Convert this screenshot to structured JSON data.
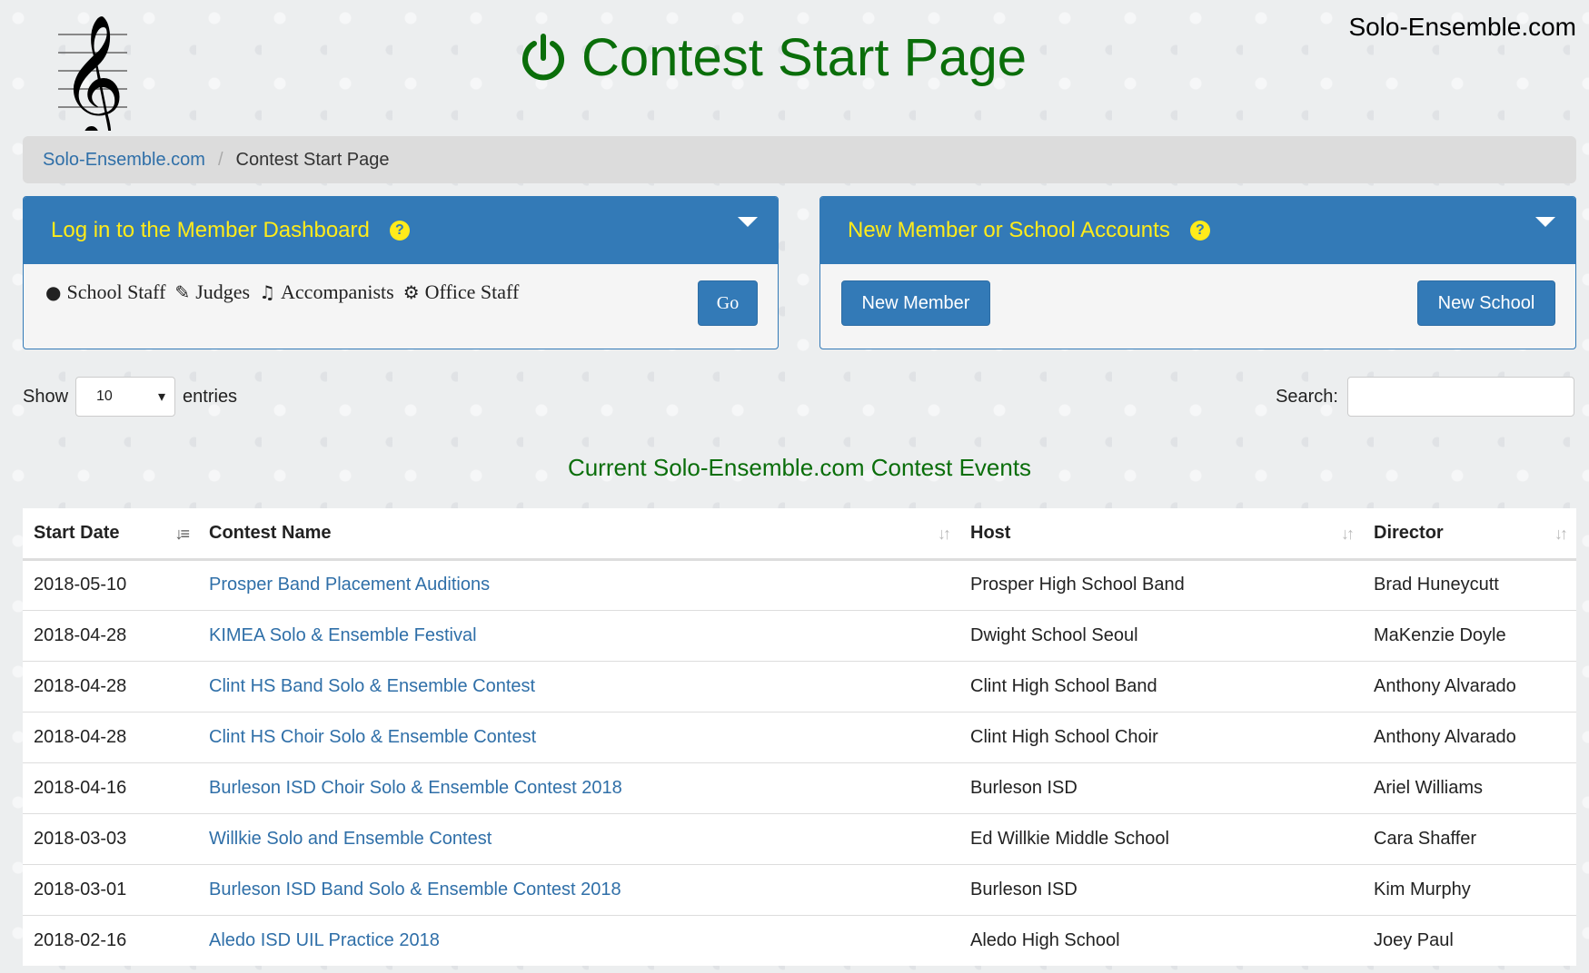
{
  "header": {
    "site_link": "Solo-Ensemble.com",
    "page_title": "Contest Start Page"
  },
  "breadcrumb": {
    "home": "Solo-Ensemble.com",
    "current": "Contest Start Page"
  },
  "login_panel": {
    "title": "Log in to the Member Dashboard",
    "roles": [
      {
        "icon": "apple-icon",
        "label": "School Staff"
      },
      {
        "icon": "edit-icon",
        "label": "Judges"
      },
      {
        "icon": "music-note-icon",
        "label": "Accompanists"
      },
      {
        "icon": "gear-icon",
        "label": "Office Staff"
      }
    ],
    "go_label": "Go"
  },
  "accounts_panel": {
    "title": "New Member or School Accounts",
    "new_member_label": "New Member",
    "new_school_label": "New School"
  },
  "table_controls": {
    "show_label": "Show",
    "entries_value": "10",
    "entries_label": "entries",
    "search_label": "Search:"
  },
  "caption": "Current Solo-Ensemble.com Contest Events",
  "table": {
    "headers": [
      "Start Date",
      "Contest Name",
      "Host",
      "Director"
    ],
    "rows": [
      {
        "date": "2018-05-10",
        "name": "Prosper Band Placement Auditions",
        "host": "Prosper High School Band",
        "director": "Brad Huneycutt"
      },
      {
        "date": "2018-04-28",
        "name": "KIMEA Solo & Ensemble Festival",
        "host": "Dwight School Seoul",
        "director": "MaKenzie Doyle"
      },
      {
        "date": "2018-04-28",
        "name": "Clint HS Band Solo & Ensemble Contest",
        "host": "Clint High School Band",
        "director": "Anthony Alvarado"
      },
      {
        "date": "2018-04-28",
        "name": "Clint HS Choir Solo & Ensemble Contest",
        "host": "Clint High School Choir",
        "director": "Anthony Alvarado"
      },
      {
        "date": "2018-04-16",
        "name": "Burleson ISD Choir Solo & Ensemble Contest 2018",
        "host": "Burleson ISD",
        "director": "Ariel Williams"
      },
      {
        "date": "2018-03-03",
        "name": "Willkie Solo and Ensemble Contest",
        "host": "Ed Willkie Middle School",
        "director": "Cara Shaffer"
      },
      {
        "date": "2018-03-01",
        "name": "Burleson ISD Band Solo & Ensemble Contest 2018",
        "host": "Burleson ISD",
        "director": "Kim Murphy"
      },
      {
        "date": "2018-02-16",
        "name": "Aledo ISD UIL Practice 2018",
        "host": "Aledo High School",
        "director": "Joey Paul"
      }
    ]
  },
  "colors": {
    "title_green": "#0a6e0a",
    "panel_blue": "#337ab7",
    "panel_title_yellow": "#ffeb1a",
    "link_blue": "#2f6fa8"
  }
}
